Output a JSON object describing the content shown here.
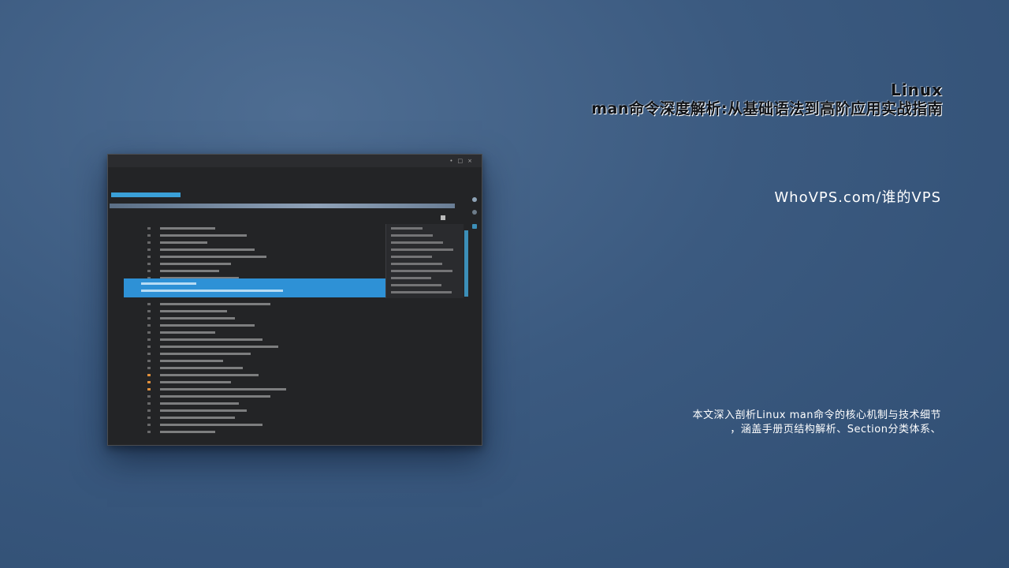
{
  "article": {
    "title_line1": "Linux",
    "title_line2": "man命令深度解析:从基础语法到高阶应用实战指南",
    "brand": "WhoVPS.com/谁的VPS",
    "description_line1": "本文深入剖析Linux man命令的核心机制与技术细节",
    "description_line2": "，涵盖手册页结构解析、Section分类体系、"
  },
  "colors": {
    "background": "#3b5a80",
    "highlight": "#2e91d6",
    "accent_orange": "#e0903c"
  }
}
